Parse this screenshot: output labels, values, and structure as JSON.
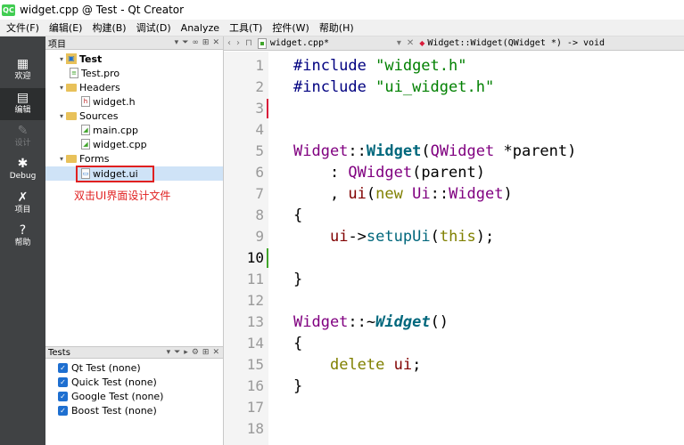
{
  "window": {
    "app_icon": "QC",
    "title": "widget.cpp @ Test - Qt Creator"
  },
  "menu": [
    "文件(F)",
    "编辑(E)",
    "构建(B)",
    "调试(D)",
    "Analyze",
    "工具(T)",
    "控件(W)",
    "帮助(H)"
  ],
  "modes": [
    {
      "label": "欢迎",
      "icon": "grid-icon",
      "glyph": "▦"
    },
    {
      "label": "编辑",
      "icon": "edit-document-icon",
      "glyph": "▤"
    },
    {
      "label": "设计",
      "icon": "pencil-icon",
      "glyph": "✎"
    },
    {
      "label": "Debug",
      "icon": "bug-icon",
      "glyph": "✱"
    },
    {
      "label": "项目",
      "icon": "wrench-icon",
      "glyph": "✗"
    },
    {
      "label": "帮助",
      "icon": "help-icon",
      "glyph": "?"
    }
  ],
  "projects": {
    "title": "项目",
    "tree": [
      {
        "label": "Test",
        "icon": "project-icon"
      },
      {
        "label": "Test.pro",
        "icon": "pro-file-icon"
      },
      {
        "label": "Headers",
        "icon": "folder-icon"
      },
      {
        "label": "widget.h",
        "icon": "header-file-icon",
        "glyph": "h"
      },
      {
        "label": "Sources",
        "icon": "folder-icon"
      },
      {
        "label": "main.cpp",
        "icon": "cpp-file-icon"
      },
      {
        "label": "widget.cpp",
        "icon": "cpp-file-icon"
      },
      {
        "label": "Forms",
        "icon": "folder-icon"
      },
      {
        "label": "widget.ui",
        "icon": "ui-file-icon"
      }
    ],
    "annotation": "双击UI界面设计文件"
  },
  "tests": {
    "title": "Tests",
    "items": [
      {
        "label": "Qt Test (none)",
        "checked": true
      },
      {
        "label": "Quick Test (none)",
        "checked": true
      },
      {
        "label": "Google Test (none)",
        "checked": true
      },
      {
        "label": "Boost Test (none)",
        "checked": true
      }
    ]
  },
  "editor": {
    "file_tab": "widget.cpp*",
    "symbol": "Widget::Widget(QWidget *) -> void",
    "current_line": "10",
    "line_numbers": [
      "1",
      "2",
      "3",
      "4",
      "5",
      "6",
      "7",
      "8",
      "9",
      "10",
      "11",
      "12",
      "13",
      "14",
      "15",
      "16",
      "17",
      "18"
    ]
  },
  "colors": {
    "mode_bar": "#404244",
    "annotation": "#e02020",
    "modified_marker": "#d81b3a",
    "saved_marker": "#41a52b"
  }
}
